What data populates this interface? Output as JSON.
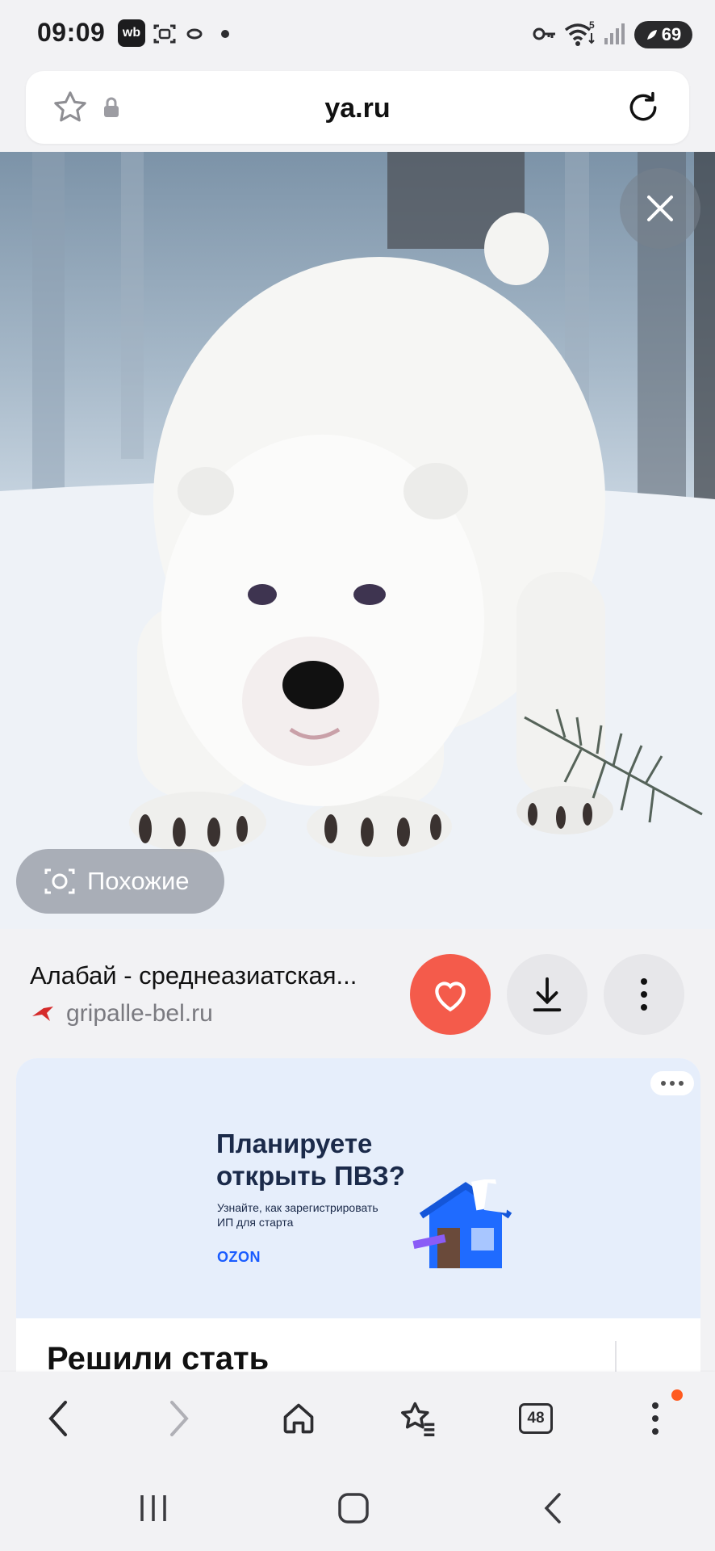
{
  "status_bar": {
    "time": "09:09",
    "badge": "wb",
    "battery": "69",
    "icons": [
      "wb-icon",
      "screenshot-icon",
      "ring-icon",
      "dot-icon",
      "key-icon",
      "wifi-icon",
      "signal-icon",
      "battery-icon"
    ]
  },
  "url_bar": {
    "domain": "ya.ru",
    "icons": [
      "star-icon",
      "lock-icon",
      "reload-icon"
    ]
  },
  "photo": {
    "subject": "white Central Asian Shepherd puppy in snow",
    "similar_label": "Похожие"
  },
  "result": {
    "title": "Алабай - среднеазиатская...",
    "source": "gripalle-bel.ru",
    "accent_color": "#f45b4b"
  },
  "ad": {
    "headline_line1": "Планируете",
    "headline_line2": "открыть ПВЗ?",
    "sub_line1": "Узнайте, как зарегистрировать",
    "sub_line2": "ИП для старта",
    "brand": "OZON",
    "second_title": "Решили стать"
  },
  "nav": {
    "tab_count": "48"
  }
}
